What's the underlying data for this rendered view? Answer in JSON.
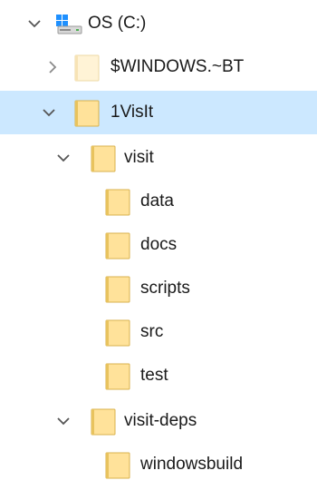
{
  "tree": {
    "items": [
      {
        "label": "OS (C:)",
        "icon": "drive-icon",
        "state": "expanded"
      },
      {
        "label": "$WINDOWS.~BT",
        "icon": "folder-icon",
        "state": "collapsed",
        "folder_style": "faded"
      },
      {
        "label": "1VisIt",
        "icon": "folder-icon",
        "state": "expanded",
        "selected": true
      },
      {
        "label": "visit",
        "icon": "folder-icon",
        "state": "expanded"
      },
      {
        "label": "data",
        "icon": "folder-icon",
        "state": "leaf"
      },
      {
        "label": "docs",
        "icon": "folder-icon",
        "state": "leaf"
      },
      {
        "label": "scripts",
        "icon": "folder-icon",
        "state": "leaf"
      },
      {
        "label": "src",
        "icon": "folder-icon",
        "state": "leaf"
      },
      {
        "label": "test",
        "icon": "folder-icon",
        "state": "leaf"
      },
      {
        "label": "visit-deps",
        "icon": "folder-icon",
        "state": "expanded"
      },
      {
        "label": "windowsbuild",
        "icon": "folder-icon",
        "state": "leaf"
      }
    ]
  },
  "colors": {
    "selection_background": "#cce8ff",
    "folder_fill": "#ffe29a",
    "folder_edge": "#d9b24c",
    "folder_faded_fill": "#fff3d6",
    "chevron": "#555555",
    "text": "#1a1a1a"
  }
}
